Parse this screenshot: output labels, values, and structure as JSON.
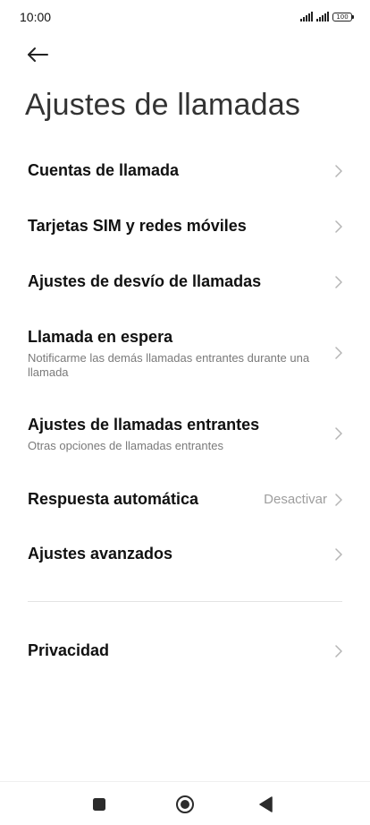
{
  "status_bar": {
    "time": "10:00",
    "battery": "100"
  },
  "header": {
    "title": "Ajustes de llamadas"
  },
  "items": [
    {
      "title": "Cuentas de llamada"
    },
    {
      "title": "Tarjetas SIM y redes móviles"
    },
    {
      "title": "Ajustes de desvío de llamadas"
    },
    {
      "title": "Llamada en espera",
      "subtitle": "Notificarme las demás llamadas entrantes durante una llamada"
    },
    {
      "title": "Ajustes de llamadas entrantes",
      "subtitle": "Otras opciones de llamadas entrantes"
    },
    {
      "title": "Respuesta automática",
      "value": "Desactivar"
    },
    {
      "title": "Ajustes avanzados"
    },
    {
      "title": "Privacidad"
    }
  ],
  "colors": {
    "background": "#ffffff",
    "title": "#111111",
    "subtitle": "#7a7a7a",
    "chevron": "#b5b5b5",
    "divider": "#e3e3e3"
  }
}
